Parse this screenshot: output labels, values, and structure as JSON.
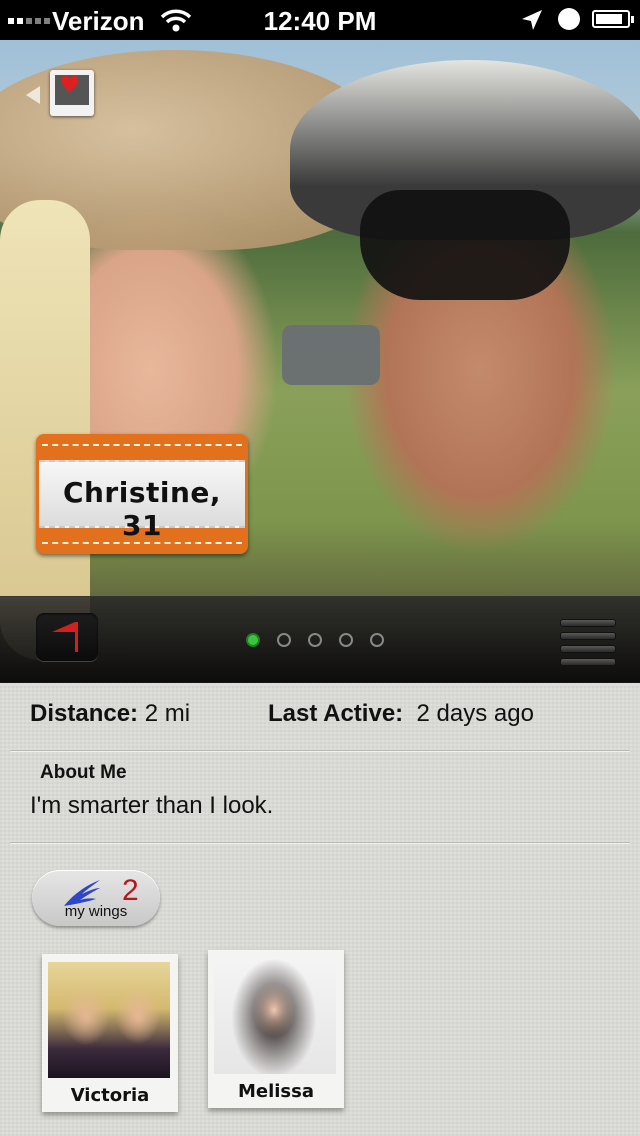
{
  "status_bar": {
    "carrier": "Verizon",
    "time": "12:40 PM",
    "battery_level": 0.85
  },
  "profile": {
    "name_tag": "Christine, 31",
    "photo_pager": {
      "total": 5,
      "active_index": 0
    }
  },
  "details": {
    "distance_label": "Distance:",
    "distance_value": "2 mi",
    "last_active_label": "Last Active:",
    "last_active_value": "2 days ago",
    "about_title": "About Me",
    "about_text": "I'm smarter than I look."
  },
  "wings": {
    "count": "2",
    "label": "my wings",
    "friends": [
      {
        "name": "Victoria"
      },
      {
        "name": "Melissa"
      }
    ]
  },
  "colors": {
    "tag_orange": "#e3701c",
    "count_red": "#b8161b",
    "dot_active": "#3fc33f",
    "wing_blue": "#2f46c8"
  }
}
